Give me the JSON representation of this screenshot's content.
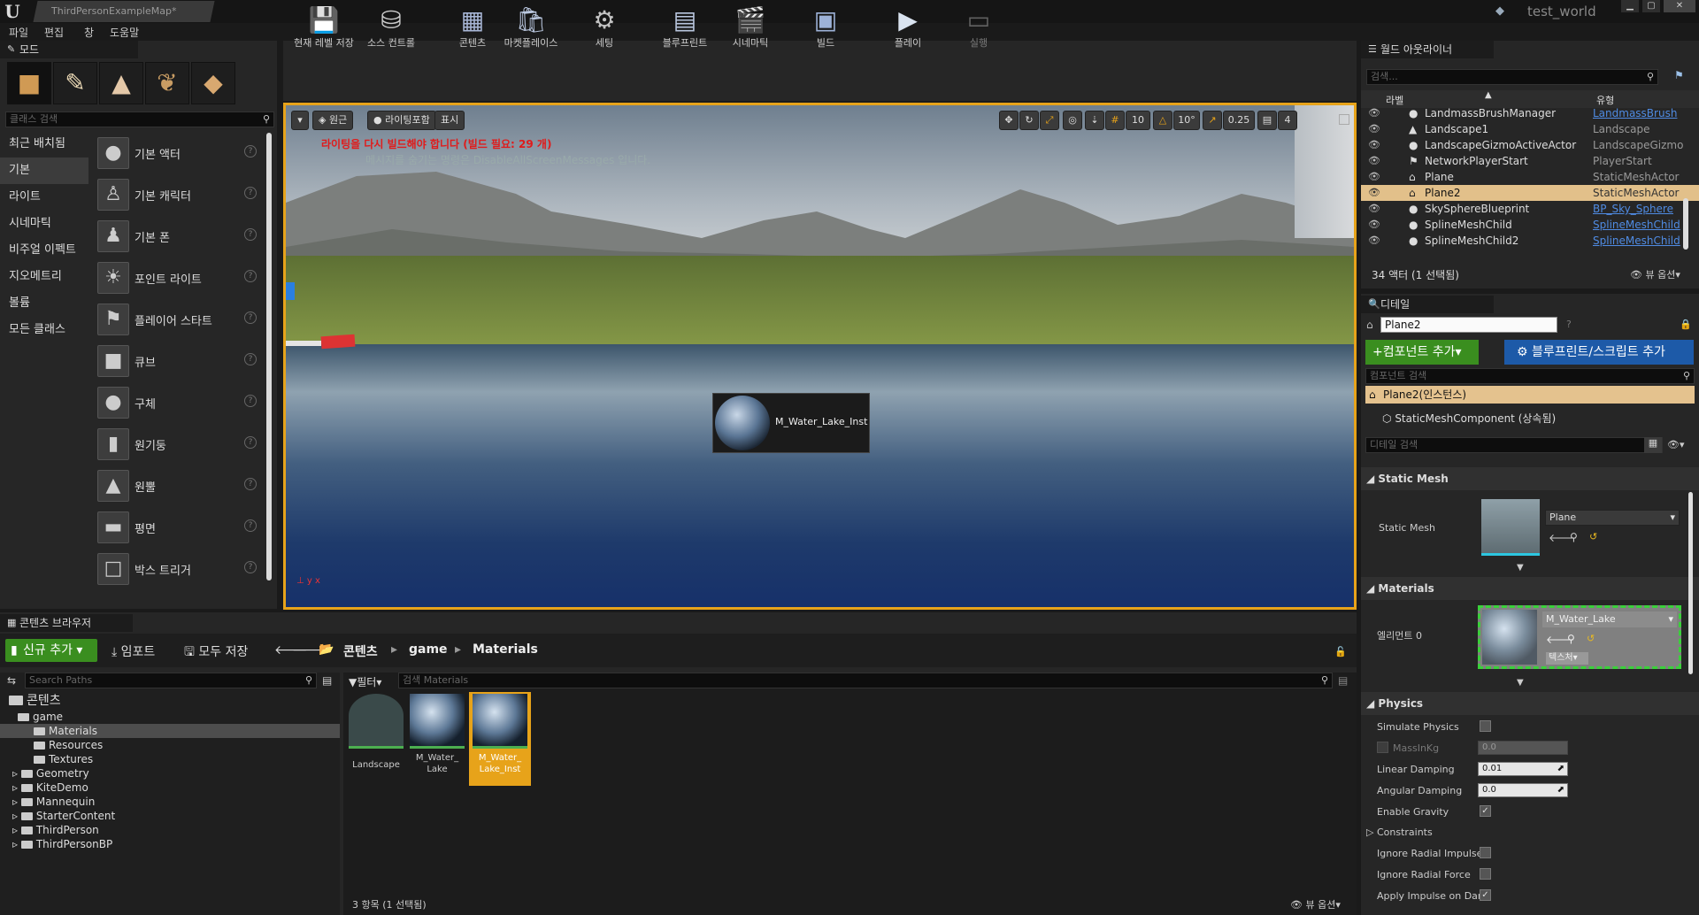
{
  "window": {
    "tab_title": "ThirdPersonExampleMap*",
    "project_name": "test_world"
  },
  "menu": [
    "파일",
    "편집",
    "창",
    "도움말"
  ],
  "modes": {
    "tab_label": "모드",
    "search_placeholder": "클래스 검색",
    "categories": [
      "최근 배치됨",
      "기본",
      "라이트",
      "시네마틱",
      "비주얼 이펙트",
      "지오메트리",
      "볼륨",
      "모든 클래스"
    ],
    "selected_category": "기본",
    "items": [
      "기본 액터",
      "기본 캐릭터",
      "기본 폰",
      "포인트 라이트",
      "플레이어 스타트",
      "큐브",
      "구체",
      "원기둥",
      "원뿔",
      "평면",
      "박스 트리거"
    ]
  },
  "toolbar": {
    "items": [
      {
        "label": "현재 레벨 저장",
        "icon": "save-icon"
      },
      {
        "label": "소스 컨트롤",
        "icon": "source-control-icon"
      },
      {
        "label": "콘텐츠",
        "icon": "content-icon"
      },
      {
        "label": "마켓플레이스",
        "icon": "marketplace-icon"
      },
      {
        "label": "세팅",
        "icon": "settings-icon"
      },
      {
        "label": "블루프린트",
        "icon": "blueprint-icon"
      },
      {
        "label": "시네마틱",
        "icon": "cinematic-icon"
      },
      {
        "label": "빌드",
        "icon": "build-icon"
      },
      {
        "label": "플레이",
        "icon": "play-icon"
      },
      {
        "label": "실행",
        "icon": "launch-icon"
      }
    ]
  },
  "viewport": {
    "perspective": "원근",
    "lighting": "라이팅포함",
    "show": "표시",
    "grid_snap": "10",
    "rotation_snap": "10°",
    "scale_snap": "0.25",
    "camera_speed": "4",
    "warning": "라이팅을 다시 빌드해야 합니다 (빌드 필요: 29 개)",
    "hint": "메시지를 숨기는 명령은 DisableAllScreenMessages 입니다.",
    "drag_asset": "M_Water_Lake_Inst"
  },
  "content_browser": {
    "tab_label": "콘텐츠 브라우저",
    "add_new": "신규 추가",
    "import": "임포트",
    "save_all": "모두 저장",
    "breadcrumbs": [
      "콘텐츠",
      "game",
      "Materials"
    ],
    "search_paths_placeholder": "Search Paths",
    "filter_label": "필터",
    "search_materials_placeholder": "검색 Materials",
    "tree": [
      {
        "label": "콘텐츠",
        "depth": 0
      },
      {
        "label": "game",
        "depth": 1
      },
      {
        "label": "Materials",
        "depth": 2
      },
      {
        "label": "Resources",
        "depth": 2
      },
      {
        "label": "Textures",
        "depth": 2
      },
      {
        "label": "Geometry",
        "depth": 1
      },
      {
        "label": "KiteDemo",
        "depth": 1
      },
      {
        "label": "Mannequin",
        "depth": 1
      },
      {
        "label": "StarterContent",
        "depth": 1
      },
      {
        "label": "ThirdPerson",
        "depth": 1
      },
      {
        "label": "ThirdPersonBP",
        "depth": 1
      }
    ],
    "assets": [
      {
        "label": "Landscape"
      },
      {
        "label": "M_Water_ Lake"
      },
      {
        "label": "M_Water_ Lake_Inst"
      }
    ],
    "status": "3 항목 (1 선택됨)",
    "view_options": "뷰 옵션"
  },
  "outliner": {
    "tab_label": "월드 아웃라이너",
    "search_placeholder": "검색...",
    "col_label": "라벨",
    "col_type": "유형",
    "rows": [
      {
        "name": "LandmassBrushManager",
        "type": "LandmassBrush",
        "link": true
      },
      {
        "name": "Landscape1",
        "type": "Landscape",
        "link": false
      },
      {
        "name": "LandscapeGizmoActiveActor",
        "type": "LandscapeGizmo",
        "link": false
      },
      {
        "name": "NetworkPlayerStart",
        "type": "PlayerStart",
        "link": false
      },
      {
        "name": "Plane",
        "type": "StaticMeshActor",
        "link": false
      },
      {
        "name": "Plane2",
        "type": "StaticMeshActor",
        "link": false
      },
      {
        "name": "SkySphereBlueprint",
        "type": "BP_Sky_Sphere",
        "link": true
      },
      {
        "name": "SplineMeshChild",
        "type": "SplineMeshChild",
        "link": true
      },
      {
        "name": "SplineMeshChild2",
        "type": "SplineMeshChild",
        "link": true
      }
    ],
    "status": "34 액터 (1 선택됨)",
    "view_options": "뷰 옵션"
  },
  "details": {
    "tab_label": "디테일",
    "name": "Plane2",
    "add_component": "컴포넌트 추가",
    "add_blueprint": "블루프린트/스크립트 추가",
    "component_search": "컴포넌트 검색",
    "instance": "Plane2(인스턴스)",
    "component": "StaticMeshComponent (상속됨)",
    "detail_search": "디테일 검색",
    "static_mesh_section": "Static Mesh",
    "static_mesh_label": "Static Mesh",
    "static_mesh_value": "Plane",
    "materials_section": "Materials",
    "element_label": "엘리먼트 0",
    "material_value": "M_Water_Lake",
    "texture_label": "텍스처",
    "physics_section": "Physics",
    "physics": [
      {
        "label": "Simulate Physics",
        "kind": "check",
        "checked": false
      },
      {
        "label": "MassInKg",
        "kind": "number",
        "value": "0.0",
        "disabled": true
      },
      {
        "label": "Linear Damping",
        "kind": "number",
        "value": "0.01"
      },
      {
        "label": "Angular Damping",
        "kind": "number",
        "value": "0.0"
      },
      {
        "label": "Enable Gravity",
        "kind": "check",
        "checked": true
      },
      {
        "label": "Constraints",
        "kind": "group"
      },
      {
        "label": "Ignore Radial Impulse",
        "kind": "check",
        "checked": false
      },
      {
        "label": "Ignore Radial Force",
        "kind": "check",
        "checked": false
      },
      {
        "label": "Apply Impulse on Dam",
        "kind": "check",
        "checked": true
      }
    ]
  }
}
